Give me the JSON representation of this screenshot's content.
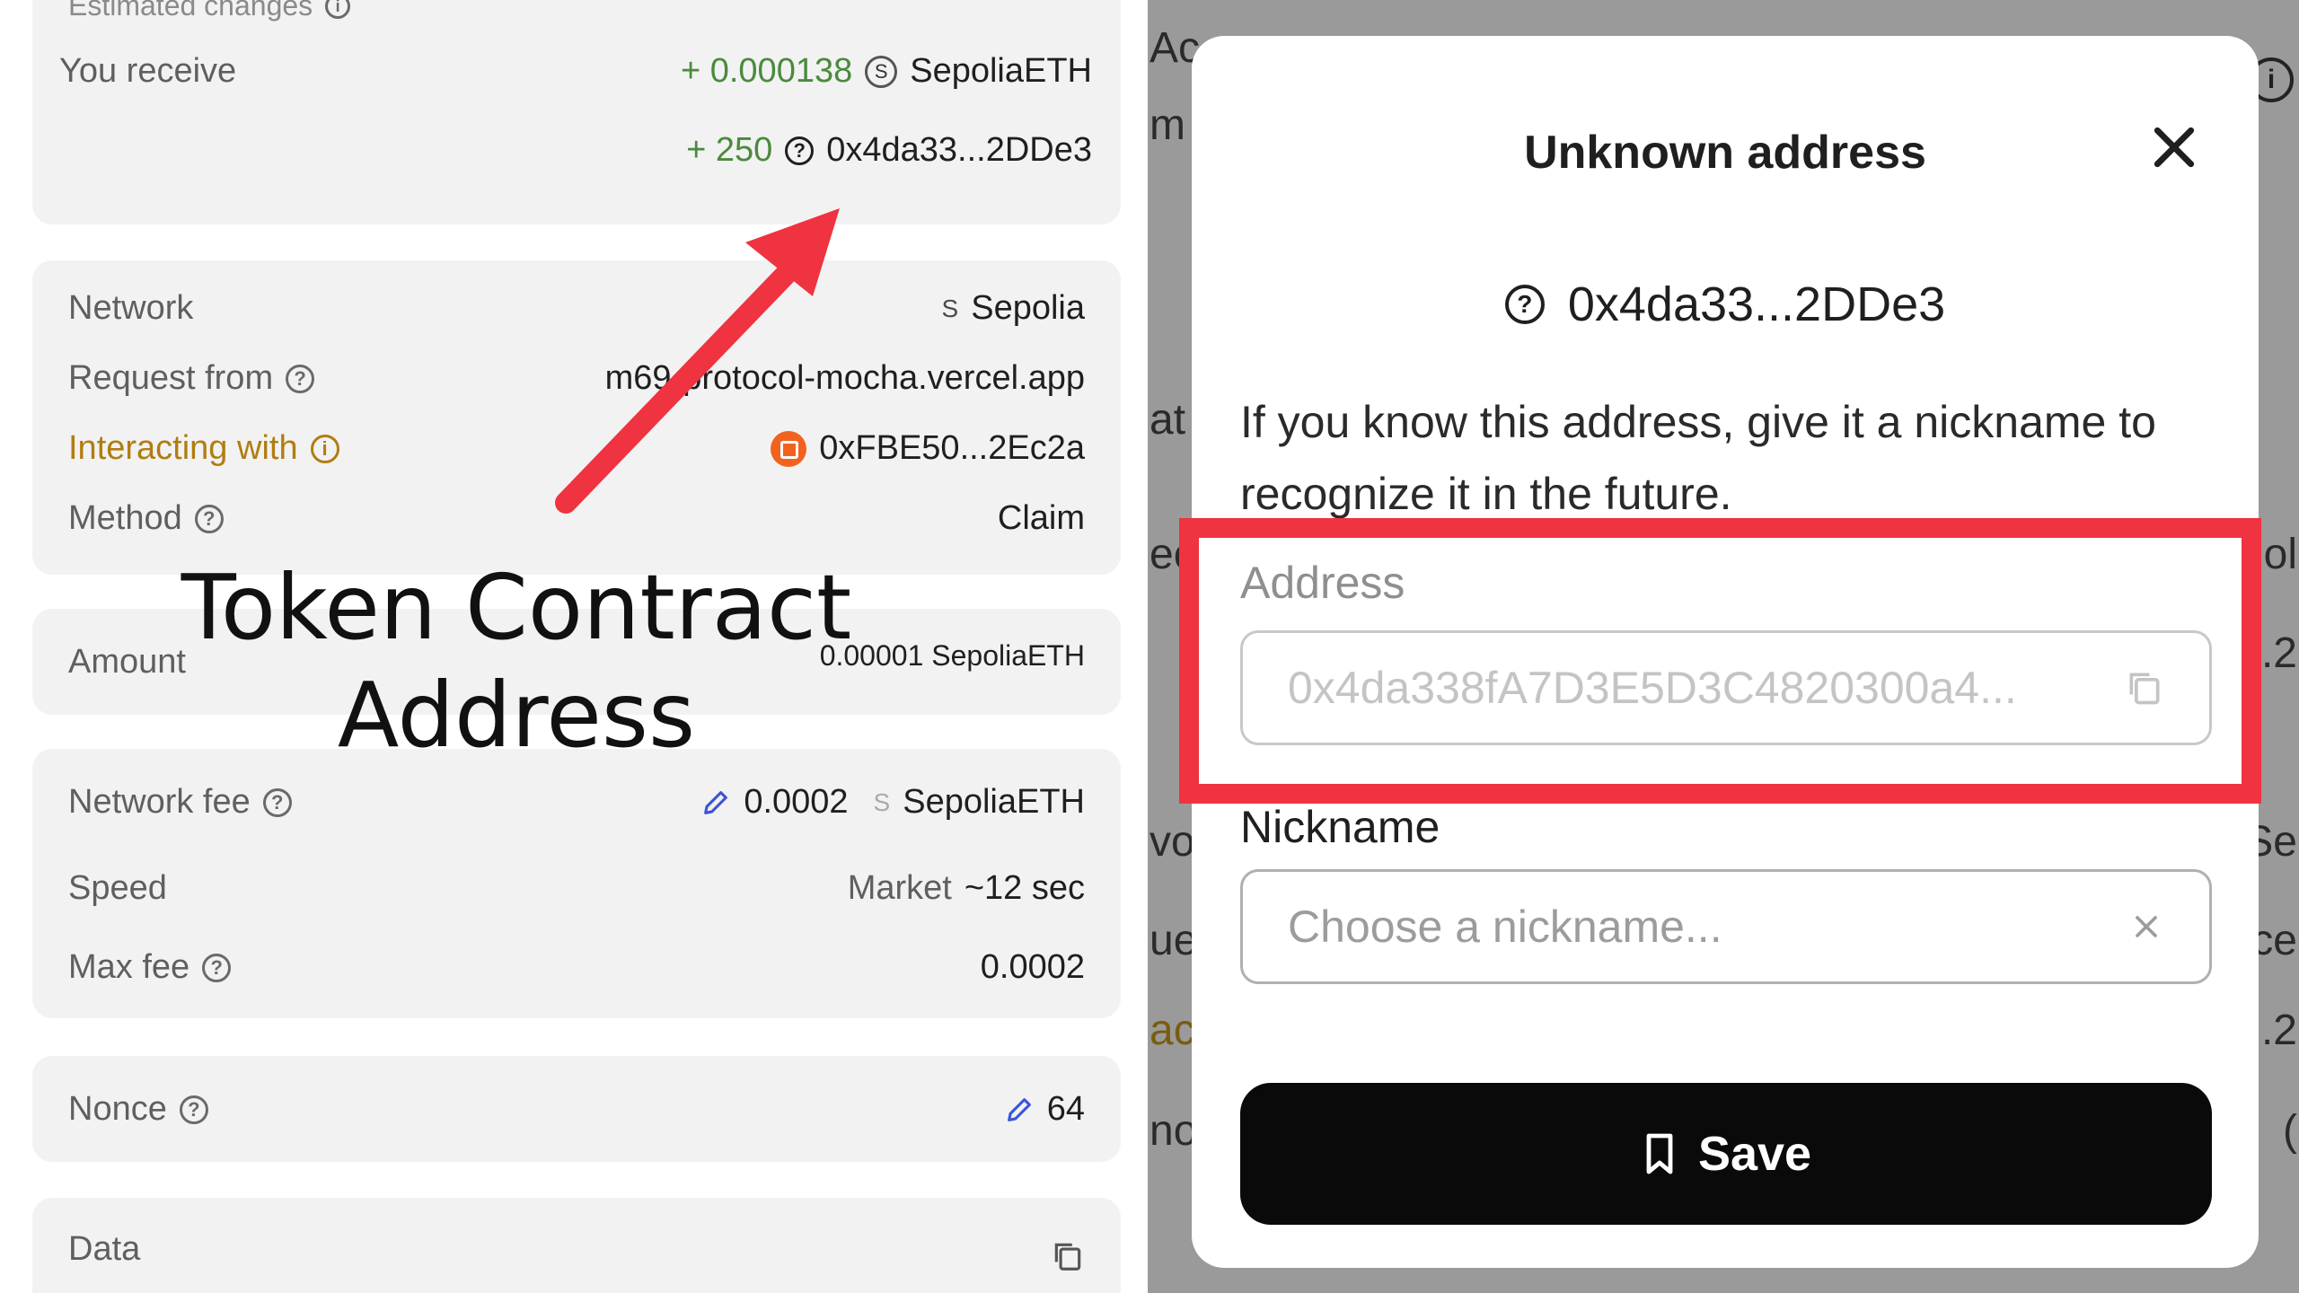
{
  "left": {
    "estimated_changes_label": "Estimated changes",
    "receive": {
      "label": "You receive",
      "amount1": "+ 0.000138",
      "token_badge": "S",
      "token1": "SepoliaETH",
      "amount2": "+ 250",
      "token2": "0x4da33...2DDe3"
    },
    "details": {
      "network_label": "Network",
      "network_badge": "S",
      "network_value": "Sepolia",
      "request_label": "Request from",
      "request_value": "m69-protocol-mocha.vercel.app",
      "interacting_label": "Interacting with",
      "interacting_value": "0xFBE50...2Ec2a",
      "method_label": "Method",
      "method_value": "Claim"
    },
    "amount": {
      "label": "Amount",
      "value": "0.00001 SepoliaETH"
    },
    "fees": {
      "network_fee_label": "Network fee",
      "network_fee_value": "0.0002",
      "network_fee_badge": "S",
      "network_fee_token": "SepoliaETH",
      "speed_label": "Speed",
      "speed_mode": "Market",
      "speed_value": "~12 sec",
      "max_fee_label": "Max fee",
      "max_fee_value": "0.0002"
    },
    "nonce": {
      "label": "Nonce",
      "value": "64"
    },
    "data": {
      "label": "Data"
    }
  },
  "annotation": {
    "line1": "Token Contract",
    "line2": "Address",
    "arrow_color": "#ef3340",
    "box_color": "#ef3340"
  },
  "modal": {
    "title": "Unknown address",
    "address_short": "0x4da33...2DDe3",
    "description": "If you know this address, give it a nickname to recognize it in the future.",
    "address_label": "Address",
    "address_value": "0x4da338fA7D3E5D3C4820300a4...",
    "nickname_label": "Nickname",
    "nickname_placeholder": "Choose a nickname...",
    "save_label": "Save"
  },
  "icons": [
    "question-icon",
    "info-icon",
    "pencil-icon",
    "copy-icon",
    "close-icon",
    "bookmark-icon",
    "clear-icon"
  ]
}
